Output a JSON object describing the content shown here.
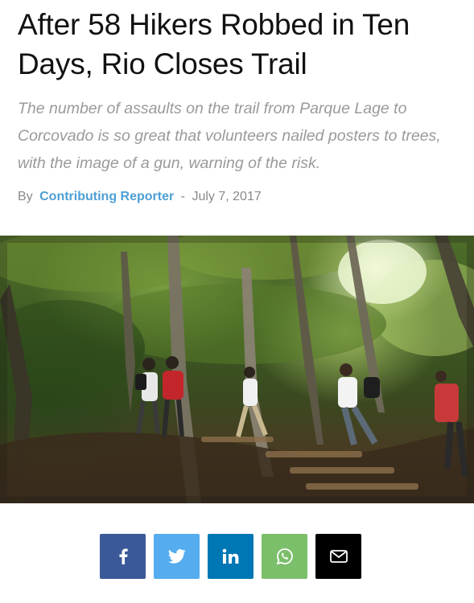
{
  "article": {
    "headline": "After 58 Hikers Robbed in Ten Days, Rio Closes Trail",
    "subheadline": "The number of assaults on the trail from Parque Lage to Corcovado is so great that volunteers nailed posters to trees, with the image of a gun, warning of the risk.",
    "byline": {
      "prefix": "By",
      "author": "Contributing Reporter",
      "separator": "-",
      "date": "July 7, 2017"
    }
  },
  "share": {
    "buttons": [
      {
        "id": "facebook",
        "glyph": "f",
        "color": "#3b5998",
        "icon": "facebook-icon"
      },
      {
        "id": "twitter",
        "glyph": "twitter-bird",
        "color": "#55acee",
        "icon": "twitter-icon"
      },
      {
        "id": "linkedin",
        "glyph": "in",
        "color": "#0077b5",
        "icon": "linkedin-icon"
      },
      {
        "id": "whatsapp",
        "glyph": "whatsapp-phone",
        "color": "#7bbf6a",
        "icon": "whatsapp-icon"
      },
      {
        "id": "email",
        "glyph": "envelope",
        "color": "#000000",
        "icon": "email-icon"
      }
    ]
  },
  "colors": {
    "headline": "#111111",
    "subheadline": "#9a9a9a",
    "author_link": "#4e9fd4",
    "meta": "#8a8a8a"
  }
}
